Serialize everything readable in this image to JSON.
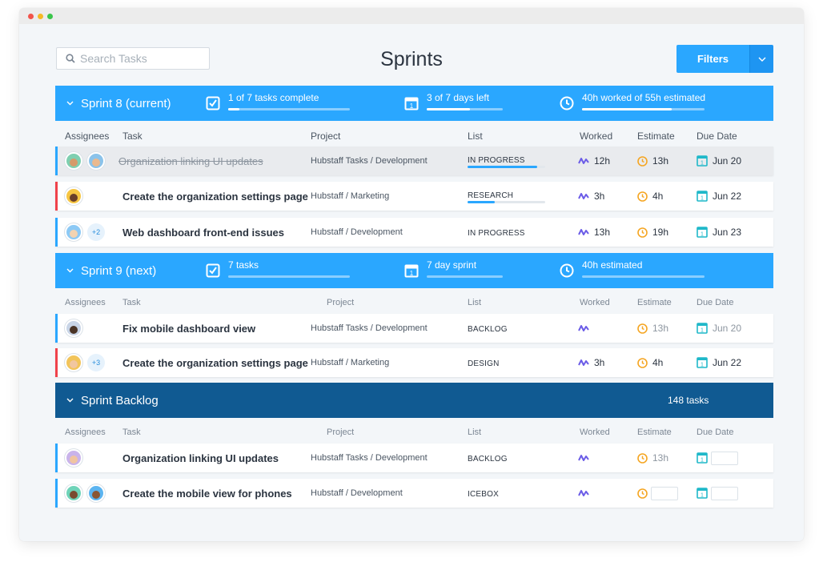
{
  "search": {
    "placeholder": "Search Tasks"
  },
  "page_title": "Sprints",
  "filters_label": "Filters",
  "columns": {
    "assignees": "Assignees",
    "task": "Task",
    "project": "Project",
    "list": "List",
    "worked": "Worked",
    "estimate": "Estimate",
    "due": "Due Date"
  },
  "sprints": [
    {
      "title": "Sprint 8 (current)",
      "tasks_stat": "1 of 7 tasks complete",
      "tasks_progress": 0.09,
      "days_stat": "3 of 7 days left",
      "days_progress": 0.57,
      "time_stat": "40h worked of 55h estimated",
      "time_progress": 0.73,
      "rows": [
        {
          "task": "Organization linking UI updates",
          "project": "Hubstaff Tasks / Development",
          "list": "IN PROGRESS",
          "list_progress": 0.9,
          "worked": "12h",
          "estimate": "13h",
          "due": "Jun 20",
          "edge": "#2aa7ff",
          "done": true,
          "extra": ""
        },
        {
          "task": "Create the organization settings page",
          "project": "Hubstaff / Marketing",
          "list": "RESEARCH",
          "list_progress": 0.35,
          "worked": "3h",
          "estimate": "4h",
          "due": "Jun 22",
          "edge": "#f0424b",
          "done": false,
          "extra": ""
        },
        {
          "task": "Web dashboard front-end issues",
          "project": "Hubstaff / Development",
          "list": "IN PROGRESS",
          "list_progress": null,
          "worked": "13h",
          "estimate": "19h",
          "due": "Jun 23",
          "edge": "#2aa7ff",
          "done": false,
          "extra": "+2"
        }
      ]
    },
    {
      "title": "Sprint 9 (next)",
      "tasks_stat": "7 tasks",
      "tasks_progress": 0,
      "days_stat": "7 day sprint",
      "days_progress": 0,
      "time_stat": "40h estimated",
      "time_progress": 0,
      "rows": [
        {
          "task": "Fix mobile dashboard view",
          "project": "Hubstaff Tasks / Development",
          "list": "BACKLOG",
          "worked": "",
          "estimate": "13h",
          "due": "Jun 20",
          "edge": "#2aa7ff",
          "extra": ""
        },
        {
          "task": "Create the organization settings page",
          "project": "Hubstaff / Marketing",
          "list": "DESIGN",
          "worked": "3h",
          "estimate": "4h",
          "due": "Jun 22",
          "edge": "#f0424b",
          "extra": "+3"
        }
      ]
    },
    {
      "title": "Sprint Backlog",
      "count": "148 tasks",
      "rows": [
        {
          "task": "Organization linking UI updates",
          "project": "Hubstaff Tasks / Development",
          "list": "BACKLOG",
          "worked": "",
          "estimate": "13h",
          "due": "",
          "edge": "#2aa7ff",
          "extra": ""
        },
        {
          "task": "Create the mobile view for phones",
          "project": "Hubstaff / Development",
          "list": "ICEBOX",
          "worked": "",
          "estimate": "",
          "due": "",
          "edge": "#2aa7ff",
          "extra": ""
        }
      ]
    }
  ],
  "colors": {
    "accent": "#2aa7ff",
    "backlog_bar": "#105a92",
    "worked_icon": "#6b5ce7",
    "estimate_icon": "#f5a623",
    "due_icon": "#1fb8c9"
  }
}
